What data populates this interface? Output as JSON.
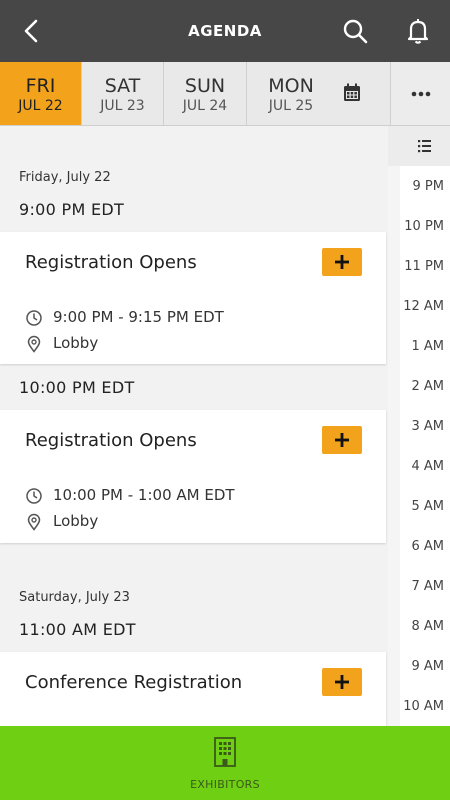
{
  "header": {
    "title": "AGENDA"
  },
  "days": [
    {
      "name": "FRI",
      "date": "JUL 22",
      "active": true
    },
    {
      "name": "SAT",
      "date": "JUL 23",
      "active": false
    },
    {
      "name": "SUN",
      "date": "JUL 24",
      "active": false
    },
    {
      "name": "MON",
      "date": "JUL 25",
      "active": false
    }
  ],
  "timeline": {
    "hours": [
      "9 PM",
      "10 PM",
      "11 PM",
      "12 AM",
      "1 AM",
      "2 AM",
      "3 AM",
      "4 AM",
      "5 AM",
      "6 AM",
      "7 AM",
      "8 AM",
      "9 AM",
      "10 AM"
    ]
  },
  "agenda": {
    "day1_label": "Friday, July 22",
    "slot1_time": "9:00 PM EDT",
    "event1": {
      "title": "Registration Opens",
      "time": "9:00 PM - 9:15 PM EDT",
      "location": "Lobby"
    },
    "slot2_time": "10:00 PM EDT",
    "event2": {
      "title": "Registration Opens",
      "time": "10:00 PM - 1:00 AM EDT",
      "location": "Lobby"
    },
    "day2_label": "Saturday, July 23",
    "slot3_time": "11:00 AM EDT",
    "event3": {
      "title": "Conference Registration"
    }
  },
  "bottom_nav": {
    "exhibitors_label": "EXHIBITORS"
  },
  "colors": {
    "header": "#474747",
    "accent": "#f2a31b",
    "bottom_bar": "#6fcf12"
  }
}
